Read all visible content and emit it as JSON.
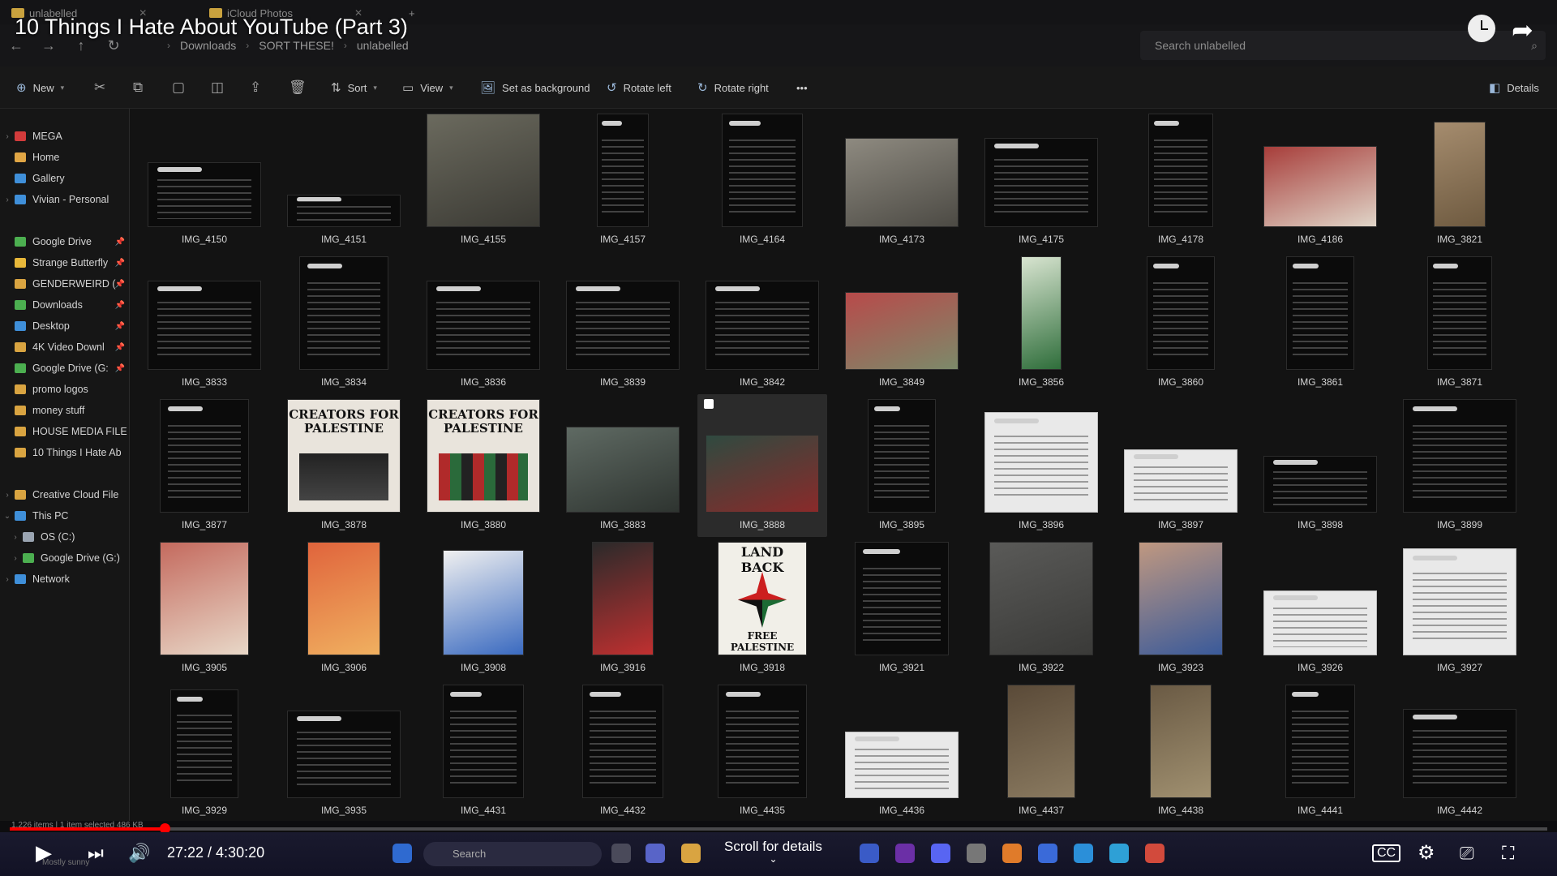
{
  "window": {
    "tabs": [
      {
        "label": "unlabelled"
      },
      {
        "label": "iCloud Photos"
      }
    ],
    "breadcrumb": [
      "Downloads",
      "SORT THESE!",
      "unlabelled"
    ],
    "search_placeholder": "Search unlabelled"
  },
  "video": {
    "title": "10 Things I Hate About YouTube (Part 3)",
    "time_current": "27:22",
    "time_total": "4:30:20",
    "time_display": "27:22 / 4:30:20",
    "progress_fraction": 0.101,
    "scroll_hint": "Scroll for details"
  },
  "toolbar": {
    "new_label": "New",
    "sort_label": "Sort",
    "view_label": "View",
    "set_background_label": "Set as background",
    "rotate_left_label": "Rotate left",
    "rotate_right_label": "Rotate right",
    "more_label": "•••",
    "details_label": "Details"
  },
  "sidebar": {
    "items": [
      {
        "label": "MEGA",
        "color": "#d23b3b",
        "chev": true
      },
      {
        "label": "Home",
        "color": "#e0a645",
        "chev": false
      },
      {
        "label": "Gallery",
        "color": "#3f8fd9",
        "chev": false
      },
      {
        "label": "Vivian - Personal",
        "color": "#3f8fd9",
        "chev": true
      },
      {
        "label": "Google Drive",
        "color": "#4caf50",
        "pin": true
      },
      {
        "label": "Strange Butterfly",
        "color": "#e8b83a",
        "pin": true
      },
      {
        "label": "GENDERWEIRD (",
        "color": "#d9a441",
        "pin": true
      },
      {
        "label": "Downloads",
        "color": "#4caf50",
        "pin": true
      },
      {
        "label": "Desktop",
        "color": "#3f8fd9",
        "pin": true
      },
      {
        "label": "4K Video Downl",
        "color": "#d9a441",
        "pin": true
      },
      {
        "label": "Google Drive (G:",
        "color": "#4caf50",
        "pin": true
      },
      {
        "label": "promo logos",
        "color": "#d9a441"
      },
      {
        "label": "money stuff",
        "color": "#d9a441"
      },
      {
        "label": "HOUSE MEDIA FILE",
        "color": "#d9a441"
      },
      {
        "label": "10 Things I Hate Ab",
        "color": "#d9a441"
      },
      {
        "label": "Creative Cloud File",
        "color": "#d9a441",
        "chev": true
      },
      {
        "label": "This PC",
        "color": "#3f8fd9",
        "chev": true,
        "open": true
      },
      {
        "label": "OS (C:)",
        "color": "#9aa4b1",
        "chev": true,
        "indent": true
      },
      {
        "label": "Google Drive (G:)",
        "color": "#4caf50",
        "chev": true,
        "indent": true
      },
      {
        "label": "Network",
        "color": "#3f8fd9",
        "chev": true
      }
    ]
  },
  "files": [
    "IMG_4150",
    "IMG_4151",
    "IMG_4155",
    "IMG_4157",
    "IMG_4164",
    "IMG_4173",
    "IMG_4175",
    "IMG_4178",
    "IMG_4186",
    "IMG_3821",
    "IMG_3833",
    "IMG_3834",
    "IMG_3836",
    "IMG_3839",
    "IMG_3842",
    "IMG_3849",
    "IMG_3856",
    "IMG_3860",
    "IMG_3861",
    "IMG_3871",
    "IMG_3877",
    "IMG_3878",
    "IMG_3880",
    "IMG_3883",
    "IMG_3888",
    "IMG_3895",
    "IMG_3896",
    "IMG_3897",
    "IMG_3898",
    "IMG_3899",
    "IMG_3905",
    "IMG_3906",
    "IMG_3908",
    "IMG_3916",
    "IMG_3918",
    "IMG_3921",
    "IMG_3922",
    "IMG_3923",
    "IMG_3926",
    "IMG_3927",
    "IMG_3929",
    "IMG_3935",
    "IMG_4431",
    "IMG_4432",
    "IMG_4435",
    "IMG_4436",
    "IMG_4437",
    "IMG_4438",
    "IMG_4441",
    "IMG_4442"
  ],
  "selected_file": "IMG_3888",
  "posters": {
    "creators": "CREATORS FOR PALESTINE",
    "land_back_top": "LAND BACK",
    "land_back_bottom": "FREE PALESTINE"
  },
  "status": {
    "text": "1,226 items  |  1 item selected  486 KB"
  },
  "taskbar": {
    "search_label": "Search",
    "weather": "Mostly sunny"
  },
  "colors": {
    "accent_red": "#ff0000",
    "folder": "#d9a441",
    "player_bg": "#121225"
  }
}
